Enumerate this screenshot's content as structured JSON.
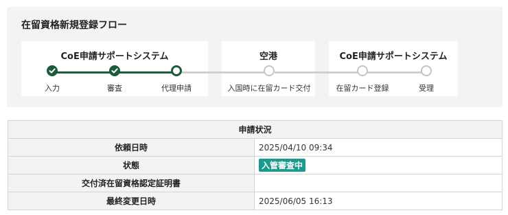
{
  "flow": {
    "title": "在留資格新規登録フロー",
    "groups": [
      {
        "title": "CoE申請サポートシステム"
      },
      {
        "title": "空港"
      },
      {
        "title": "CoE申請サポートシステム"
      }
    ],
    "steps": [
      {
        "label": "入力",
        "state": "done"
      },
      {
        "label": "審査",
        "state": "done"
      },
      {
        "label": "代理申請",
        "state": "current"
      },
      {
        "label": "入国時に在留カード交付",
        "state": "todo"
      },
      {
        "label": "在留カード登録",
        "state": "todo"
      },
      {
        "label": "受理",
        "state": "todo"
      }
    ]
  },
  "status_table": {
    "header": "申請状況",
    "rows": [
      {
        "key": "依頼日時",
        "value": "2025/04/10 09:34"
      },
      {
        "key": "状態",
        "value": "入管審査中"
      },
      {
        "key": "交付済在留資格認定証明書",
        "value": ""
      },
      {
        "key": "最終変更日時",
        "value": "2025/06/05 16:13"
      }
    ]
  },
  "colors": {
    "accent": "#1a5c3a",
    "badge": "#1a9a8c",
    "inactive": "#cfcfcf"
  }
}
